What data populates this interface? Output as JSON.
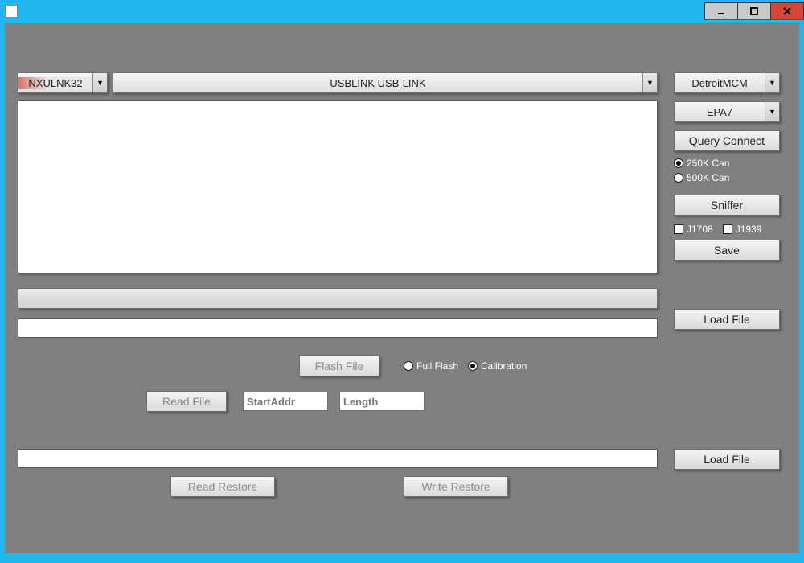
{
  "titlebar": {
    "title": ""
  },
  "dropdowns": {
    "adapter": "NXULNK32",
    "device": "USBLINK USB-LINK",
    "ecu": "DetroitMCM",
    "cal": "EPA7"
  },
  "buttons": {
    "query_connect": "Query Connect",
    "sniffer": "Sniffer",
    "save": "Save",
    "load_file_1": "Load File",
    "load_file_2": "Load File",
    "flash_file": "Flash File",
    "read_file": "Read File",
    "read_restore": "Read Restore",
    "write_restore": "Write Restore"
  },
  "radios": {
    "can250": "250K Can",
    "can500": "500K Can",
    "full_flash": "Full Flash",
    "calibration": "Calibration"
  },
  "checks": {
    "j1708": "J1708",
    "j1939": "J1939"
  },
  "inputs": {
    "start_addr_placeholder": "StartAddr",
    "length_placeholder": "Length"
  }
}
